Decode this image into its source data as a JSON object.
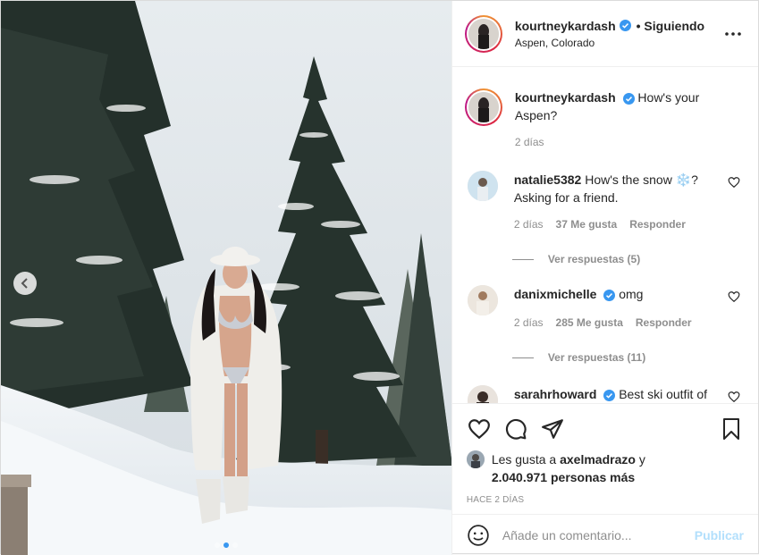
{
  "post": {
    "author": "kourtneykardash",
    "follow_status": "• Siguiendo",
    "location": "Aspen, Colorado",
    "more_icon": "more-options-icon"
  },
  "caption": {
    "username": "kourtneykardash",
    "text": "How's your Aspen?",
    "time": "2 días"
  },
  "comments": [
    {
      "username": "natalie5382",
      "text_before": "How's the snow ",
      "emoji": "❄️",
      "text_after": "? Asking for a friend.",
      "time": "2 días",
      "likes": "37 Me gusta",
      "reply": "Responder",
      "view_replies": "Ver respuestas (5)"
    },
    {
      "username": "danixmichelle",
      "text": "omg",
      "time": "2 días",
      "likes": "285 Me gusta",
      "reply": "Responder",
      "view_replies": "Ver respuestas (11)"
    },
    {
      "username": "sarahrhoward",
      "text": "Best ski outfit of"
    }
  ],
  "likes": {
    "prefix": "Les gusta a",
    "user": "axelmadrazo",
    "joiner": "y",
    "others": "2.040.971 personas más"
  },
  "timestamp": "HACE 2 DÍAS",
  "add_comment": {
    "placeholder": "Añade un comentario...",
    "publish": "Publicar"
  },
  "colors": {
    "verified": "#3897f0",
    "publish_disabled": "#b2dffc",
    "muted": "#8e8e8e"
  },
  "carousel": {
    "total": 3,
    "current": 2
  }
}
